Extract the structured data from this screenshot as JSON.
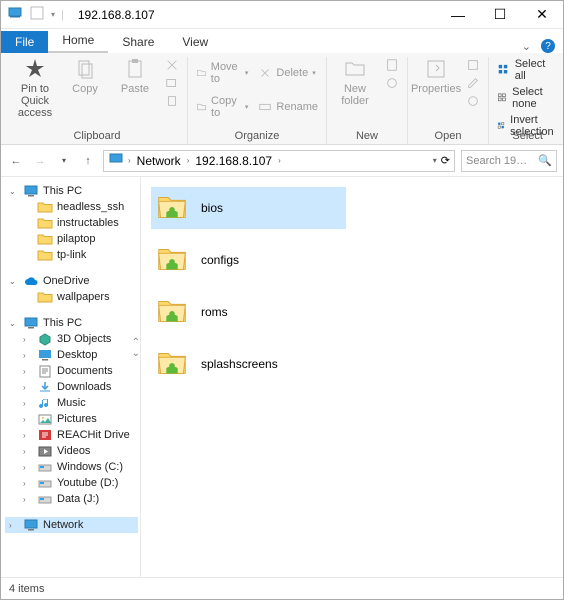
{
  "window": {
    "title": "192.168.8.107"
  },
  "tabs": {
    "file": "File",
    "home": "Home",
    "share": "Share",
    "view": "View"
  },
  "ribbon": {
    "clipboard": {
      "pin": "Pin to Quick access",
      "copy": "Copy",
      "paste": "Paste",
      "label": "Clipboard"
    },
    "organize": {
      "moveto": "Move to",
      "delete": "Delete",
      "copyto": "Copy to",
      "rename": "Rename",
      "label": "Organize"
    },
    "new": {
      "newfolder": "New folder",
      "label": "New"
    },
    "open": {
      "properties": "Properties",
      "label": "Open"
    },
    "select": {
      "all": "Select all",
      "none": "Select none",
      "invert": "Invert selection",
      "label": "Select"
    }
  },
  "address": {
    "network": "Network",
    "host": "192.168.8.107"
  },
  "search": {
    "placeholder": "Search 19…"
  },
  "tree": {
    "thispc_top": "This PC",
    "quick": [
      {
        "label": "headless_ssh"
      },
      {
        "label": "instructables"
      },
      {
        "label": "pilaptop"
      },
      {
        "label": "tp-link"
      }
    ],
    "onedrive": "OneDrive",
    "onedrive_children": [
      {
        "label": "wallpapers"
      }
    ],
    "thispc": "This PC",
    "thispc_children": [
      {
        "label": "3D Objects",
        "icon": "3d"
      },
      {
        "label": "Desktop",
        "icon": "desktop"
      },
      {
        "label": "Documents",
        "icon": "docs"
      },
      {
        "label": "Downloads",
        "icon": "down"
      },
      {
        "label": "Music",
        "icon": "music"
      },
      {
        "label": "Pictures",
        "icon": "pics"
      },
      {
        "label": "REACHit Drive",
        "icon": "reach"
      },
      {
        "label": "Videos",
        "icon": "video"
      },
      {
        "label": "Windows (C:)",
        "icon": "drive"
      },
      {
        "label": "Youtube (D:)",
        "icon": "drive"
      },
      {
        "label": "Data (J:)",
        "icon": "drive"
      }
    ],
    "network": "Network"
  },
  "items": [
    {
      "label": "bios",
      "selected": true
    },
    {
      "label": "configs",
      "selected": false
    },
    {
      "label": "roms",
      "selected": false
    },
    {
      "label": "splashscreens",
      "selected": false
    }
  ],
  "status": {
    "count": "4 items"
  }
}
